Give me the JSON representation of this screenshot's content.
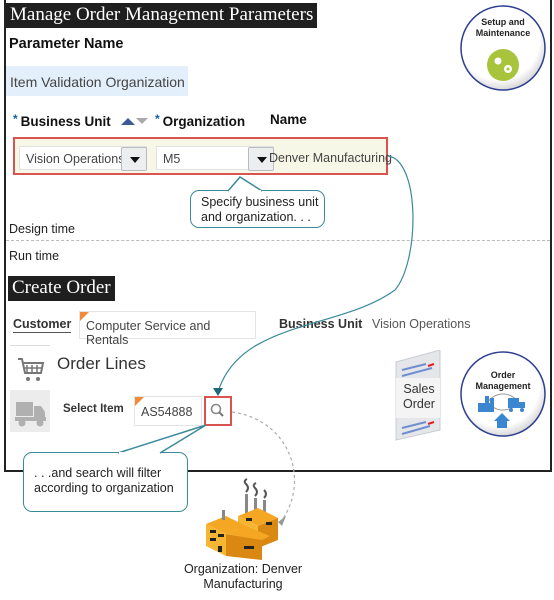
{
  "setup_panel": {
    "title": "Manage Order Management Parameters",
    "parameter_header": "Parameter Name",
    "parameter_value": "Item Validation Organization",
    "columns": {
      "business_unit": "Business Unit",
      "organization": "Organization",
      "name": "Name",
      "required_marker": "*"
    },
    "row": {
      "business_unit": "Vision Operations",
      "organization": "M5",
      "name": "Denver Manufacturing"
    }
  },
  "badges": {
    "setup": {
      "line1": "Setup and",
      "line2": "Maintenance",
      "icon": "gears-icon",
      "color": "#a8c43c"
    },
    "order_management": {
      "line1": "Order",
      "line2": "Management",
      "icon": "supply-chain-icon",
      "color": "#3a86d0"
    }
  },
  "callouts": {
    "specify": {
      "line1": "Specify business unit",
      "line2": "and organization. . ."
    },
    "search": {
      "line1": ". . .and search will filter",
      "line2": "according to organization"
    }
  },
  "phases": {
    "design": "Design time",
    "run": "Run time"
  },
  "create_order": {
    "title": "Create Order",
    "customer_label": "Customer",
    "customer_value": "Computer Service and Rentals",
    "business_unit_label": "Business Unit",
    "business_unit_value": "Vision Operations",
    "order_lines_title": "Order Lines",
    "select_item_label": "Select Item",
    "select_item_value": "AS54888"
  },
  "sales_order_doc": {
    "line1": "Sales",
    "line2": "Order"
  },
  "organization_caption": {
    "line1": "Organization: Denver",
    "line2": "Manufacturing"
  },
  "colors": {
    "highlight_border": "#d9534f",
    "connector": "#3a8a9a",
    "title_bar": "#1f1f1f",
    "param_row_bg": "#e3f0fb",
    "required_marker": "#0b5fa5",
    "factory": "#f5a623"
  }
}
